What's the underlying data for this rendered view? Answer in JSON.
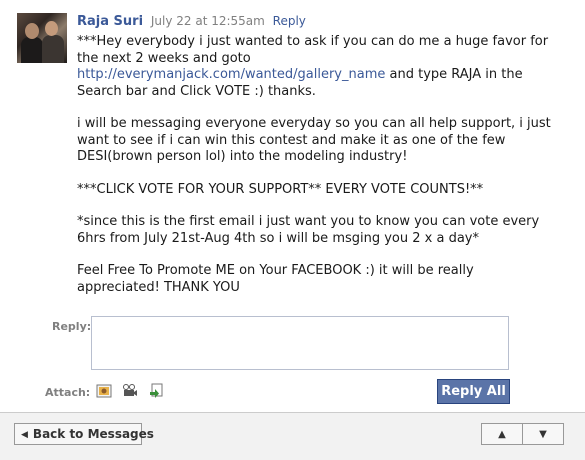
{
  "message": {
    "author": "Raja Suri",
    "date": "July 22 at 12:55am",
    "reply_link": "Reply",
    "paragraphs": [
      {
        "before": "***Hey everybody i just wanted to ask if you can do me a huge favor for the next 2 weeks and goto ",
        "link": "http://everymanjack.com/wanted/gallery_name",
        "after": " and type RAJA in the Search bar and Click VOTE :) thanks."
      },
      {
        "text": "i will be messaging everyone everyday so you can all help support, i just want to see if i can win this contest and make it as one of the few DESI(brown person lol) into the modeling industry!"
      },
      {
        "text": "***CLICK VOTE FOR YOUR SUPPORT** EVERY VOTE COUNTS!**"
      },
      {
        "text": "*since this is the first email i just want you to know you can vote every 6hrs from July 21st-Aug 4th so i will be msging you 2 x a day*"
      },
      {
        "text": "Feel Free To Promote ME on Your FACEBOOK :) it will be really appreciated! THANK YOU"
      }
    ]
  },
  "composer": {
    "reply_label": "Reply:",
    "reply_value": "",
    "attach_label": "Attach:",
    "attach_icons": [
      "photo-icon",
      "video-icon",
      "link-icon"
    ],
    "reply_all_label": "Reply All"
  },
  "footer": {
    "back_label": "Back to Messages",
    "prev_icon": "▲",
    "next_icon": "▼"
  },
  "colors": {
    "link": "#3b5998",
    "button": "#5b74a8"
  }
}
